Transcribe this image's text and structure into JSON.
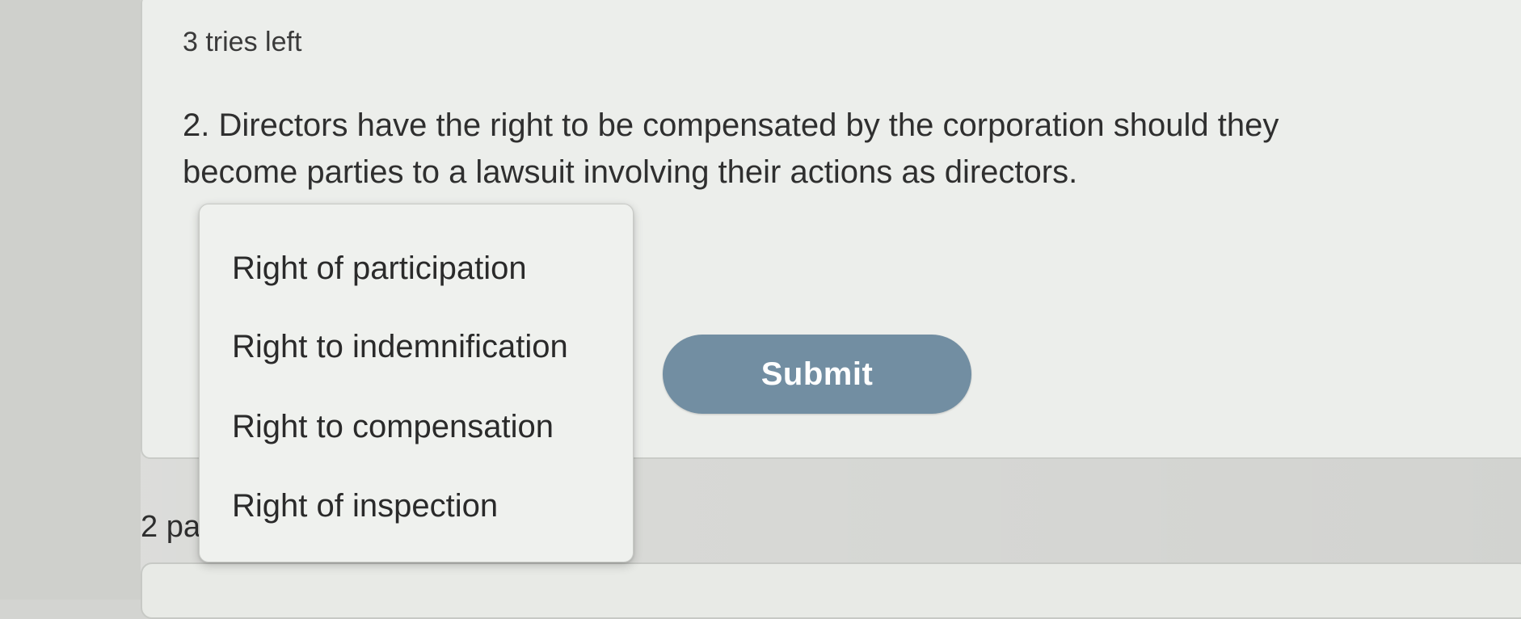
{
  "question": {
    "tries_left": "3 tries left",
    "text": "2. Directors have the right to be compensated by the corporation should they become parties to a lawsuit involving their actions as directors."
  },
  "dropdown": {
    "items": [
      {
        "label": "Right of participation"
      },
      {
        "label": "Right to indemnification"
      },
      {
        "label": "Right to compensation"
      },
      {
        "label": "Right of inspection"
      }
    ]
  },
  "actions": {
    "submit_label": "Submit"
  },
  "next_question": {
    "partial_label": "2 pa"
  },
  "colors": {
    "submit_button": "#728ea2",
    "card_background": "#eceeeb",
    "page_background": "#d9dad7"
  }
}
